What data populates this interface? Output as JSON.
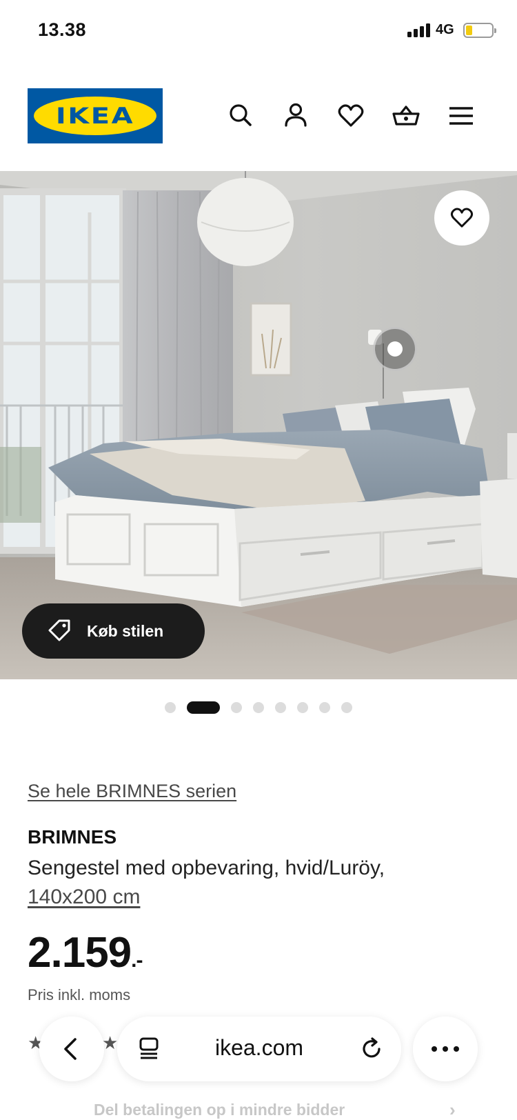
{
  "status_bar": {
    "time": "13.38",
    "network": "4G",
    "battery_level": 0.25
  },
  "header": {
    "logo_text": "IKEA",
    "icons": [
      "search-icon",
      "account-icon",
      "favorites-icon",
      "basket-icon",
      "menu-icon"
    ]
  },
  "hero": {
    "shop_style_label": "Køb stilen",
    "favorite_icon": "heart-icon",
    "slide_count": 8,
    "active_slide": 2
  },
  "product": {
    "series_link": "Se hele BRIMNES serien",
    "name": "BRIMNES",
    "description": "Sengestel med opbevaring, hvid/Luröy,",
    "size": "140x200 cm",
    "price": "2.159",
    "price_suffix": ".-",
    "price_note": "Pris inkl. moms",
    "installment_text": "Del betalingen op i mindre bidder"
  },
  "browser": {
    "url": "ikea.com",
    "buttons": [
      "back-icon",
      "tabs-icon",
      "reload-icon",
      "more-icon"
    ]
  },
  "colors": {
    "ikea_blue": "#0058a3",
    "ikea_yellow": "#ffdb00",
    "active_dot": "#111111",
    "inactive_dot": "#dcdcdc"
  }
}
